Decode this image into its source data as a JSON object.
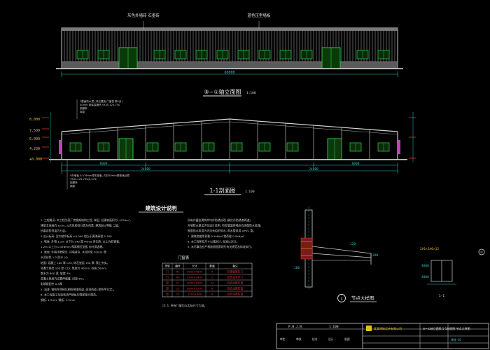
{
  "elevation": {
    "label_left": "灰色外墙砖 石墨砖",
    "label_right": "蓝色压型墙板",
    "title": "⑧~①轴立面图",
    "scale": "1:100",
    "dim": "60000"
  },
  "section": {
    "title": "1-1剖面图",
    "scale": "1:100",
    "notes_top": [
      "Y屋面防水层 (详见建施 门窗表 第1页)",
      "50mm 厚保温隔热 YX35-125-750",
      "钢檩条",
      "钢梁"
    ],
    "notes_bottom": [
      "Y外墙板 0.476mm厚彩钢板, 内衬50mm厚玻璃丝棉",
      "YX35-125-750(0.476)",
      "钢檩条",
      "钢梁"
    ],
    "elev_labels": [
      "8.000",
      "7.500",
      "6.000",
      "4.200",
      "±0.000"
    ],
    "dims": [
      "6000",
      "24000",
      "24000",
      "6000"
    ]
  },
  "design_notes": {
    "title": "建筑设计说明",
    "items": [
      "1. 工程概况: 本工程为某厂房钢架结构工程, 单层, 总建筑面积为: 4234m²;",
      "   建筑主体高约 8.0m, 火灾危险性分类为丙类, 建筑耐火等级 二级;",
      "   抗震设防烈度为七度。",
      "2.设计标高: 室内地坪标高 ±0.000 相当于黄海高程 5.300",
      "3. 墙体: 外墙 1.2m 以下为 240 厚 MU10 多孔砖, 以上为彩钢板;",
      "   1.2m 以上为 0.476mm 厚彩钢压型板 内衬保温棉。",
      "4. 屋面: 外墙详细做法, 内墙抹灰, 水泥砂浆 20mm 厚;",
      "   水泥砂浆 1:2 防水 (4)",
      "   地面: 混凝土 100 厚 C20, 碎石垫层 150 厚, 素土夯实。",
      "   混凝土垫层 100 厚 C15, 厚度为 40mm, 标高 50mm",
      "   散水为 600 宽, 坡度 4%",
      "   混凝土垫层内设置伸缩缝, 间距 6m。",
      "   彩钢板配件 0.5厚",
      "5. 油漆: 钢构件除锈后刷防锈漆两道, 面漆两道 (颜色甲方定)。",
      "6. 本工程施工及验收须严格执行国家现行规范。",
      "   钢板: 1.5mm     钢板: 1.5mm"
    ],
    "right_items": [
      "所有外露金属构件均作防锈处理 (刷红丹防锈漆两道),",
      "外墙防水做法详见设计说明, 所有管道穿墙处均须做防水处理。",
      "屋面排水采用内天沟有组织排水, 雨水管采用 UPVC 管。",
      "7. 建筑物使用荷载 0.5kN/㎡     雪荷载 0.5kN/㎡",
      "8. 本工程所有尺寸以毫米计, 标高以米计。",
      "9. 未尽事宜应严格按照国家现行有关规范及标准执行。"
    ]
  },
  "door_table": {
    "title": "门窗表",
    "headers": [
      "类型",
      "编号",
      "尺寸",
      "数量",
      "备注"
    ],
    "rows": [
      [
        "门",
        "M1",
        "4000×4000",
        "4",
        "彩钢板推拉门"
      ],
      [
        "门",
        "M2",
        "1500×2400",
        "2",
        "铝合金平开门"
      ],
      [
        "窗",
        "C1",
        "3000×1800",
        "24",
        "铝合金推拉窗"
      ],
      [
        "窗",
        "C2",
        "1800×1500",
        "8",
        "铝合金推拉窗"
      ],
      [
        "窗",
        "C3",
        "1200×900",
        "4",
        "铝合金推拉窗"
      ]
    ],
    "note": "注: 1. 所有门窗均以实际尺寸为准。"
  },
  "detail": {
    "title": "节点大样图",
    "number": "1",
    "marker": "①",
    "labels": [
      "120",
      "200",
      "180"
    ],
    "sub": "1-1",
    "dims": [
      "4000",
      "4000"
    ],
    "side_label": "2A1×2A0×12"
  },
  "title_block": {
    "design_no": "P.B.J.B",
    "scale": "1:100",
    "company": "某某建筑设计有限公司",
    "project": "⑧~①轴立面图 1-1剖面图 节点大样图",
    "drawing_no": "建施-03",
    "rows": [
      "审定",
      "审核",
      "校对",
      "设计",
      "制图"
    ]
  },
  "colors": {
    "line": "#d8d8d8",
    "green": "#2fbf3f",
    "yellow": "#e0c020",
    "red": "#e03030",
    "cyan": "#30c0c0",
    "magenta": "#c040c0"
  }
}
